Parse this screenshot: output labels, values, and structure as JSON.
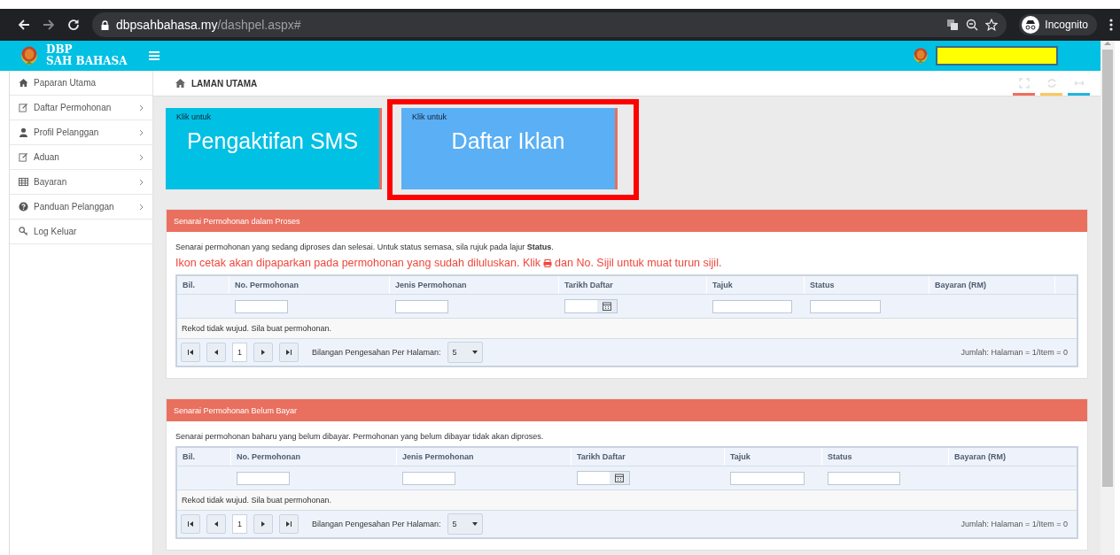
{
  "browser": {
    "url_host": "dbpsahbahasa.my",
    "url_path": "/dashpel.aspx#",
    "profile": "Incognito"
  },
  "header": {
    "logo_line1": "DBP",
    "logo_line2": "SAH BAHASA"
  },
  "sidebar": {
    "items": [
      {
        "label": "Paparan Utama",
        "expandable": false
      },
      {
        "label": "Daftar Permohonan",
        "expandable": true
      },
      {
        "label": "Profil Pelanggan",
        "expandable": true
      },
      {
        "label": "Aduan",
        "expandable": true
      },
      {
        "label": "Bayaran",
        "expandable": true
      },
      {
        "label": "Panduan Pelanggan",
        "expandable": true
      },
      {
        "label": "Log Keluar",
        "expandable": false
      }
    ]
  },
  "breadcrumb": "LAMAN UTAMA",
  "tiles": [
    {
      "caption": "Klik untuk",
      "title": "Pengaktifan SMS",
      "color": "#00c0e4",
      "highlighted": false
    },
    {
      "caption": "Klik untuk",
      "title": "Daftar Iklan",
      "color": "#5aaff5",
      "highlighted": true
    }
  ],
  "panels": [
    {
      "title": "Senarai Permohonan dalam Proses",
      "description": "Senarai permohonan yang sedang diproses dan selesai. Untuk status semasa, sila rujuk pada lajur **Status**.",
      "note": [
        "Ikon cetak akan dipaparkan pada permohonan yang sudah diluluskan. Klik",
        "dan No. Sijil untuk muat turun sijil."
      ],
      "columns": [
        {
          "label": "Bil.",
          "kind": "none"
        },
        {
          "label": "No. Permohonan",
          "kind": "text"
        },
        {
          "label": "Jenis Permohonan",
          "kind": "text"
        },
        {
          "label": "Tarikh Daftar",
          "kind": "date"
        },
        {
          "label": "Tajuk",
          "kind": "text"
        },
        {
          "label": "Status",
          "kind": "text"
        },
        {
          "label": "Bayaran (RM)",
          "kind": "none"
        }
      ],
      "empty_message": "Rekod tidak wujud. Sila buat permohonan.",
      "page": "1",
      "per_page_label": "Bilangan Pengesahan Per Halaman:",
      "per_page": "5",
      "summary": "Jumlah: Halaman = 1/Item = 0"
    },
    {
      "title": "Senarai Permohonan Belum Bayar",
      "description": "Senarai permohonan baharu yang belum dibayar. Permohonan yang belum dibayar tidak akan diproses.",
      "columns": [
        {
          "label": "Bil.",
          "kind": "none"
        },
        {
          "label": "No. Permohonan",
          "kind": "text"
        },
        {
          "label": "Jenis Permohonan",
          "kind": "text"
        },
        {
          "label": "Tarikh Daftar",
          "kind": "date"
        },
        {
          "label": "Tajuk",
          "kind": "text"
        },
        {
          "label": "Status",
          "kind": "text"
        },
        {
          "label": "Bayaran (RM)",
          "kind": "none"
        }
      ],
      "empty_message": "Rekod tidak wujud. Sila buat permohonan.",
      "page": "1",
      "per_page_label": "Bilangan Pengesahan Per Halaman:",
      "per_page": "5",
      "summary": "Jumlah: Halaman = 1/Item = 0"
    }
  ]
}
